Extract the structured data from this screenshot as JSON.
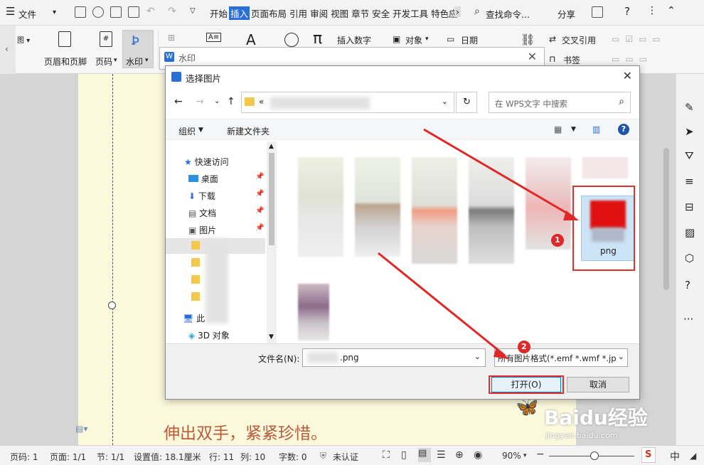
{
  "menubar": {
    "file_label": "文件",
    "tabs": [
      "开始",
      "插入",
      "页面布局",
      "引用",
      "审阅",
      "视图",
      "章节",
      "安全",
      "开发工具",
      "特色应"
    ],
    "active_tab": "插入",
    "search_label": "查找命令...",
    "share_label": "分享"
  },
  "ribbon": {
    "header_footer": "页眉和页脚",
    "page_number": "页码",
    "watermark": "水印",
    "insert_number": "插入数字",
    "object": "对象",
    "date": "日期",
    "cross_ref": "交叉引用",
    "bookmark": "书签"
  },
  "watermark_dialog": {
    "title": "水印"
  },
  "file_dialog": {
    "title": "选择图片",
    "path_prefix": "«",
    "search_placeholder": "在 WPS文字 中搜索",
    "organize": "组织",
    "new_folder": "新建文件夹",
    "nav": [
      {
        "label": "快速访问",
        "icon": "star-icon"
      },
      {
        "label": "桌面",
        "icon": "desktop-icon"
      },
      {
        "label": "下载",
        "icon": "download-icon"
      },
      {
        "label": "文档",
        "icon": "document-icon"
      },
      {
        "label": "图片",
        "icon": "picture-icon"
      },
      {
        "label": "此",
        "icon": "computer-icon"
      },
      {
        "label": "3D 对象",
        "icon": "3d-icon"
      }
    ],
    "selected_file_label": "png",
    "filename_label": "文件名(N):",
    "filename_value": ".png",
    "filter_value": "所有图片格式(*.emf *.wmf *.jp",
    "open_button": "打开(O)",
    "cancel_button": "取消"
  },
  "annotations": [
    "1",
    "2"
  ],
  "document": {
    "text": "伸出双手，紧紧珍惜。"
  },
  "watermark_logo": {
    "text": "Baidu经验",
    "sub": "jingyan.baidu.com"
  },
  "statusbar": {
    "page_code": "页码: 1",
    "pages": "页面: 1/1",
    "section": "节: 1/1",
    "setting": "设置值: 18.1厘米",
    "row": "行: 11",
    "col": "列: 10",
    "word_count": "字数: 0",
    "cert": "未认证",
    "zoom": "90%",
    "ime": "中"
  }
}
